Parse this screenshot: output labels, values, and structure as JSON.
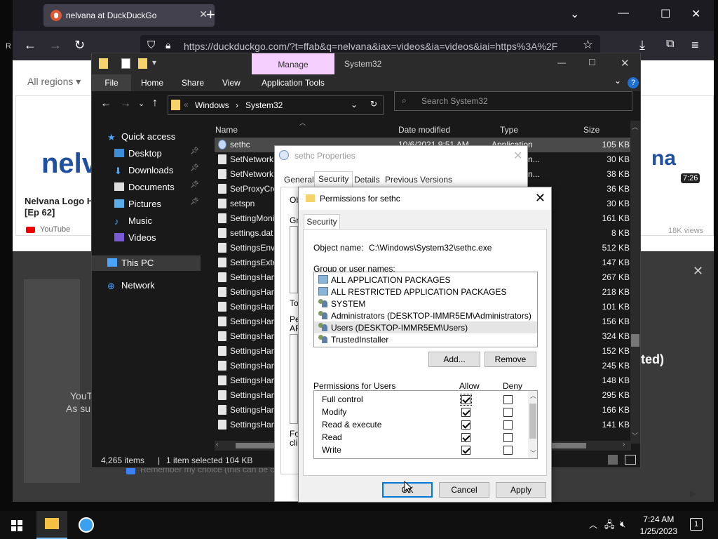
{
  "browser": {
    "tab_title": "nelvana at DuckDuckGo",
    "url_host": "duckduckgo.com",
    "url_full": "https://duckduckgo.com/?t=ffab&q=nelvana&iax=videos&ia=videos&iai=https%3A%2F",
    "regions_label": "All regions",
    "video_card": {
      "title": "Nelvana Logo Hi [Ep 62]",
      "source": "YouTube",
      "duration": "7:26",
      "views": "18K views",
      "thumb_text_1": "nelv",
      "thumb_text_2": "na"
    },
    "overlay": {
      "text1": "YouT",
      "text2": "As su",
      "text_right": "ted)",
      "remember": "Remember my choice (this can be ch"
    },
    "left_edge_char": "R"
  },
  "explorer": {
    "title": "System32",
    "manage": "Manage",
    "ribbon": [
      "File",
      "Home",
      "Share",
      "View",
      "Application Tools"
    ],
    "path": [
      "Windows",
      "System32"
    ],
    "search_placeholder": "Search System32",
    "nav": {
      "quick_access": "Quick access",
      "desktop": "Desktop",
      "downloads": "Downloads",
      "documents": "Documents",
      "pictures": "Pictures",
      "music": "Music",
      "videos": "Videos",
      "this_pc": "This PC",
      "network": "Network"
    },
    "columns": {
      "name": "Name",
      "date": "Date modified",
      "type": "Type",
      "size": "Size"
    },
    "files": [
      {
        "name": "sethc",
        "date": "10/6/2021 9:51 AM",
        "type": "Application",
        "size": "105 KB"
      },
      {
        "name": "SetNetworkL",
        "date": "",
        "type": "ation exten...",
        "size": "30 KB"
      },
      {
        "name": "SetNetworkL",
        "date": "",
        "type": "ation exten...",
        "size": "38 KB"
      },
      {
        "name": "SetProxyCre",
        "date": "",
        "type": "ation exten...",
        "size": "36 KB"
      },
      {
        "name": "setspn",
        "date": "",
        "type": "",
        "size": "30 KB"
      },
      {
        "name": "SettingMoni",
        "date": "",
        "type": "",
        "size": "161 KB"
      },
      {
        "name": "settings.dat",
        "date": "",
        "type": "",
        "size": "8 KB"
      },
      {
        "name": "SettingsEnvi",
        "date": "",
        "type": "ten...",
        "size": "512 KB"
      },
      {
        "name": "SettingsExte",
        "date": "",
        "type": "ten...",
        "size": "147 KB"
      },
      {
        "name": "SettingsHan",
        "date": "",
        "type": "ten...",
        "size": "267 KB"
      },
      {
        "name": "SettingsHan",
        "date": "",
        "type": "ten...",
        "size": "218 KB"
      },
      {
        "name": "SettingsHan",
        "date": "",
        "type": "ten...",
        "size": "101 KB"
      },
      {
        "name": "SettingsHan",
        "date": "",
        "type": "ten...",
        "size": "156 KB"
      },
      {
        "name": "SettingsHan",
        "date": "",
        "type": "ten...",
        "size": "324 KB"
      },
      {
        "name": "SettingsHan",
        "date": "",
        "type": "ten...",
        "size": "152 KB"
      },
      {
        "name": "SettingsHan",
        "date": "",
        "type": "ten...",
        "size": "245 KB"
      },
      {
        "name": "SettingsHan",
        "date": "",
        "type": "ten...",
        "size": "148 KB"
      },
      {
        "name": "SettingsHan",
        "date": "",
        "type": "ten...",
        "size": "295 KB"
      },
      {
        "name": "SettingsHan",
        "date": "",
        "type": "ten...",
        "size": "166 KB"
      },
      {
        "name": "SettingsHan",
        "date": "",
        "type": "ten...",
        "size": "141 KB"
      }
    ],
    "status": {
      "count": "4,265 items",
      "selected": "1 item selected  104 KB"
    }
  },
  "props": {
    "title": "sethc Properties",
    "tabs": [
      "General",
      "Security",
      "Details",
      "Previous Versions"
    ],
    "frag": {
      "ob": "Ob",
      "gr": "Gr",
      "to": "To",
      "pe": "Pe",
      "ap": "AP",
      "fo": "Fo",
      "cli": "cli"
    }
  },
  "perm": {
    "title": "Permissions for sethc",
    "tab": "Security",
    "object_label": "Object name:",
    "object_value": "C:\\Windows\\System32\\sethc.exe",
    "group_label": "Group or user names:",
    "users": [
      {
        "name": "ALL APPLICATION PACKAGES",
        "kind": "group"
      },
      {
        "name": "ALL RESTRICTED APPLICATION PACKAGES",
        "kind": "group"
      },
      {
        "name": "SYSTEM",
        "kind": "user"
      },
      {
        "name": "Administrators (DESKTOP-IMMR5EM\\Administrators)",
        "kind": "user"
      },
      {
        "name": "Users (DESKTOP-IMMR5EM\\Users)",
        "kind": "user"
      },
      {
        "name": "TrustedInstaller",
        "kind": "user"
      }
    ],
    "add": "Add...",
    "remove": "Remove",
    "perm_for": "Permissions for Users",
    "allow": "Allow",
    "deny": "Deny",
    "permissions": [
      {
        "name": "Full control",
        "allow": true,
        "deny": false
      },
      {
        "name": "Modify",
        "allow": true,
        "deny": false
      },
      {
        "name": "Read & execute",
        "allow": true,
        "deny": false
      },
      {
        "name": "Read",
        "allow": true,
        "deny": false
      },
      {
        "name": "Write",
        "allow": true,
        "deny": false
      }
    ],
    "ok": "OK",
    "cancel": "Cancel",
    "apply": "Apply"
  },
  "taskbar": {
    "time": "7:24 AM",
    "date": "1/25/2023",
    "notif_count": "1"
  }
}
